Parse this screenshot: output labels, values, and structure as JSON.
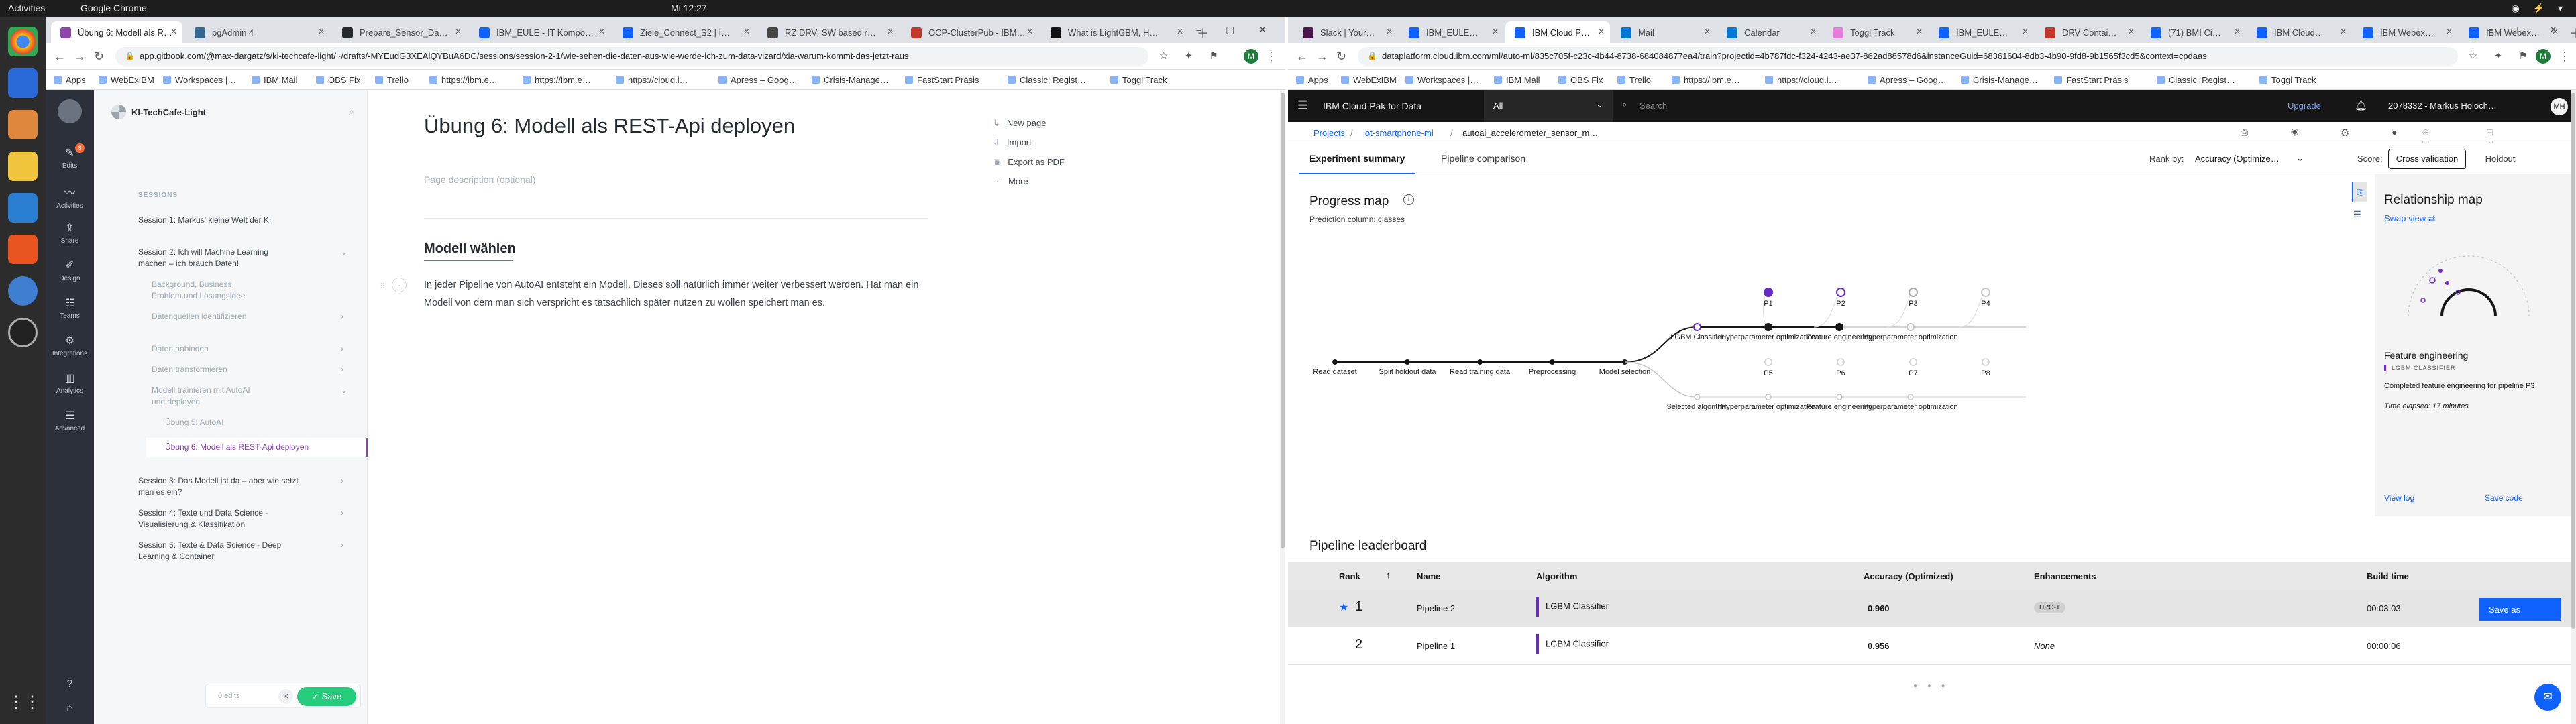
{
  "system": {
    "activities": "Activities",
    "app_name": "Google Chrome",
    "clock": "Mi 12:27"
  },
  "left_window": {
    "tabs": [
      {
        "title": "Übung 6: Modell als R…",
        "active": true,
        "color": "#8e44ad"
      },
      {
        "title": "pgAdmin 4",
        "active": false,
        "color": "#336791"
      },
      {
        "title": "Prepare_Sensor_Da…",
        "active": false,
        "color": "#24292e"
      },
      {
        "title": "IBM_EULE - IT Kompo…",
        "active": false,
        "color": "#0f62fe"
      },
      {
        "title": "Ziele_Connect_S2 | I…",
        "active": false,
        "color": "#0f62fe"
      },
      {
        "title": "RZ DRV: SW based r…",
        "active": false,
        "color": "#444444"
      },
      {
        "title": "OCP-ClusterPub - IBM…",
        "active": false,
        "color": "#c0392b"
      },
      {
        "title": "What is LightGBM, H…",
        "active": false,
        "color": "#111111"
      }
    ],
    "url": "app.gitbook.com/@max-dargatz/s/ki-techcafe-light/~/drafts/-MYEudG3XEAlQYBuA6DC/sessions/session-2-1/wie-sehen-die-daten-aus-wie-werde-ich-zum-data-vizard/xia-warum-kommt-das-jetzt-raus",
    "profile_initial": "M",
    "bookmarks": [
      "Apps",
      "WebExIBM",
      "Workspaces |…",
      "IBM Mail",
      "OBS Fix",
      "Trello",
      "https://ibm.e…",
      "https://ibm.e…",
      "https://cloud.i…",
      "Apress – Goog…",
      "Crisis-Manage…",
      "FastStart Präsis",
      "Classic: Regist…",
      "Toggl Track"
    ],
    "rail": [
      {
        "label": "Edits",
        "icon": "✎"
      },
      {
        "label": "Activities",
        "icon": "〰"
      },
      {
        "label": "Share",
        "icon": "⇪"
      },
      {
        "label": "Design",
        "icon": "✐"
      },
      {
        "label": "Teams",
        "icon": "☷"
      },
      {
        "label": "Integrations",
        "icon": "⚙"
      },
      {
        "label": "Analytics",
        "icon": "▥"
      },
      {
        "label": "Advanced",
        "icon": "☰"
      }
    ],
    "rail_badge": "8",
    "space_title": "KI-TechCafe-Light",
    "sidebar_heading": "SESSIONS",
    "sidebar_items": [
      {
        "text": "Session 1: Markus' kleine Welt der KI",
        "level": "top",
        "chevron": ""
      },
      {
        "text": "Session 2: Ich will Machine Learning machen – ich brauch Daten!",
        "level": "top",
        "chevron": "⌄"
      },
      {
        "text": "Background, Business Problem und Lösungsidee",
        "level": "sub",
        "chevron": ""
      },
      {
        "text": "Datenquellen identifizieren",
        "level": "sub",
        "chevron": "›"
      },
      {
        "text": "Daten anbinden",
        "level": "sub",
        "chevron": "›"
      },
      {
        "text": "Daten transformieren",
        "level": "sub",
        "chevron": "›"
      },
      {
        "text": "Modell trainieren mit AutoAI und deployen",
        "level": "sub",
        "chevron": "⌄"
      },
      {
        "text": "Übung 5: AutoAI",
        "level": "subsub",
        "chevron": ""
      },
      {
        "text": "Übung 6: Modell als REST-Api deployen",
        "level": "active",
        "chevron": ""
      },
      {
        "text": "Session 3: Das Modell ist da – aber wie setzt man es ein?",
        "level": "top",
        "chevron": "›"
      },
      {
        "text": "Session 4: Texte und Data Science - Visualisierung & Klassifikation",
        "level": "top",
        "chevron": "›"
      },
      {
        "text": "Session 5: Texte & Data Science - Deep Learning & Container",
        "level": "top",
        "chevron": "›"
      }
    ],
    "edits_count": "0 edits",
    "save_label": "Save",
    "page_title": "Übung 6: Modell als REST-Api deployen",
    "page_description": "Page description (optional)",
    "page_actions": [
      "New page",
      "Import",
      "Export as PDF",
      "More"
    ],
    "section_heading": "Modell wählen",
    "body_text": "In jeder Pipeline von AutoAI entsteht ein Modell. Dieses soll natürlich immer weiter verbessert werden. Hat man ein Modell von dem man sich verspricht es tatsächlich später nutzen zu wollen speichert man es."
  },
  "right_window": {
    "tabs": [
      {
        "title": "Slack | Your…",
        "active": false,
        "color": "#4a154b"
      },
      {
        "title": "IBM_EULE…",
        "active": false,
        "color": "#0f62fe"
      },
      {
        "title": "IBM Cloud P…",
        "active": true,
        "color": "#0f62fe"
      },
      {
        "title": "Mail",
        "active": false,
        "color": "#0078d4"
      },
      {
        "title": "Calendar",
        "active": false,
        "color": "#0078d4"
      },
      {
        "title": "Toggl Track",
        "active": false,
        "color": "#e57cd8"
      },
      {
        "title": "IBM_EULE…",
        "active": false,
        "color": "#0f62fe"
      },
      {
        "title": "DRV Contai…",
        "active": false,
        "color": "#c0392b"
      },
      {
        "title": "(71) BMI Ci…",
        "active": false,
        "color": "#0f62fe"
      },
      {
        "title": "IBM Cloud…",
        "active": false,
        "color": "#0f62fe"
      },
      {
        "title": "IBM Webex…",
        "active": false,
        "color": "#0f62fe"
      },
      {
        "title": "IBM Webex…",
        "active": false,
        "color": "#0f62fe"
      }
    ],
    "url": "dataplatform.cloud.ibm.com/ml/auto-ml/835c705f-c23c-4b44-8738-684084877ea4/train?projectid=4b787fdc-f324-4243-ae37-862ad88578d6&instanceGuid=68361604-8db3-4b90-9fd8-9b1565f3cd5&context=cpdaas",
    "profile_initial": "M",
    "bookmarks": [
      "Apps",
      "WebExIBM",
      "Workspaces |…",
      "IBM Mail",
      "OBS Fix",
      "Trello",
      "https://ibm.e…",
      "https://cloud.i…",
      "Apress – Goog…",
      "Crisis-Manage…",
      "FastStart Präsis",
      "Classic: Regist…",
      "Toggl Track"
    ],
    "ibm_title": "IBM Cloud Pak for Data",
    "scope": "All",
    "search_placeholder": "Search",
    "upgrade": "Upgrade",
    "account": "2078332 - Markus Holoch…",
    "avatar": "MH",
    "breadcrumb": [
      "Projects",
      "iot-smartphone-ml",
      "autoai_accelerometer_sensor_m…"
    ],
    "tabs_main": [
      "Experiment summary",
      "Pipeline comparison"
    ],
    "rank_by_label": "Rank by:",
    "rank_by_value": "Accuracy (Optimize…",
    "score_label": "Score:",
    "score_options": [
      "Cross validation",
      "Holdout"
    ],
    "progress_title": "Progress map",
    "prediction_column": "Prediction column:  classes",
    "progress_steps": [
      "Read dataset",
      "Split holdout data",
      "Read training data",
      "Preprocessing",
      "Model selection"
    ],
    "pipeline_nodes_top": [
      "LGBM Classifier",
      "Hyperparameter optimization",
      "Feature engineering",
      "Hyperparameter optimization"
    ],
    "pipeline_nodes_bottom": [
      "Selected algorithm",
      "Hyperparameter optimization",
      "Feature engineering",
      "Hyperparameter optimization"
    ],
    "pipeline_labels_top": [
      "P1",
      "P2",
      "P3",
      "P4"
    ],
    "pipeline_labels_bottom": [
      "P5",
      "P6",
      "P7",
      "P8"
    ],
    "relationship_title": "Relationship map",
    "swap_view": "Swap view",
    "detail_title": "Feature engineering",
    "detail_sub": "LGBM CLASSIFIER",
    "detail_desc": "Completed feature engineering for pipeline P3",
    "detail_time": "Time elapsed: 17 minutes",
    "view_log": "View log",
    "save_code": "Save code",
    "leaderboard_title": "Pipeline leaderboard",
    "leaderboard_headers": [
      "Rank",
      "Name",
      "Algorithm",
      "Accuracy (Optimized)",
      "Enhancements",
      "Build time"
    ],
    "leaderboard_rows": [
      {
        "rank": "1",
        "name": "Pipeline 2",
        "algorithm": "LGBM Classifier",
        "accuracy": "0.960",
        "enhancements": "HPO-1",
        "build_time": "00:03:03",
        "starred": true,
        "action": "Save as"
      },
      {
        "rank": "2",
        "name": "Pipeline 1",
        "algorithm": "LGBM Classifier",
        "accuracy": "0.956",
        "enhancements": "None",
        "build_time": "00:00:06",
        "starred": false,
        "action": ""
      }
    ]
  }
}
